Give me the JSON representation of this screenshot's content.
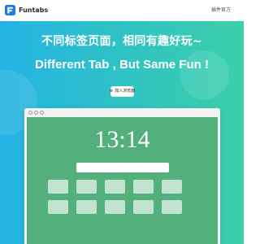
{
  "header": {
    "brand": "Funtabs",
    "nav_link": "插件官方"
  },
  "hero": {
    "title_cn": "不同标签页面，相同有趣好玩~",
    "title_en": "Different Tab , But Same Fun !",
    "add_button_icon": "plus-icon",
    "add_button_label": "加入浏览器"
  },
  "preview": {
    "clock": "13:14",
    "shortcut_count_visible": 10
  },
  "colors": {
    "hero_gradient_start": "#25b3e6",
    "hero_gradient_end": "#3dd0a9",
    "preview_background": "#53b07c",
    "logo_blue": "#1e7ce6"
  }
}
